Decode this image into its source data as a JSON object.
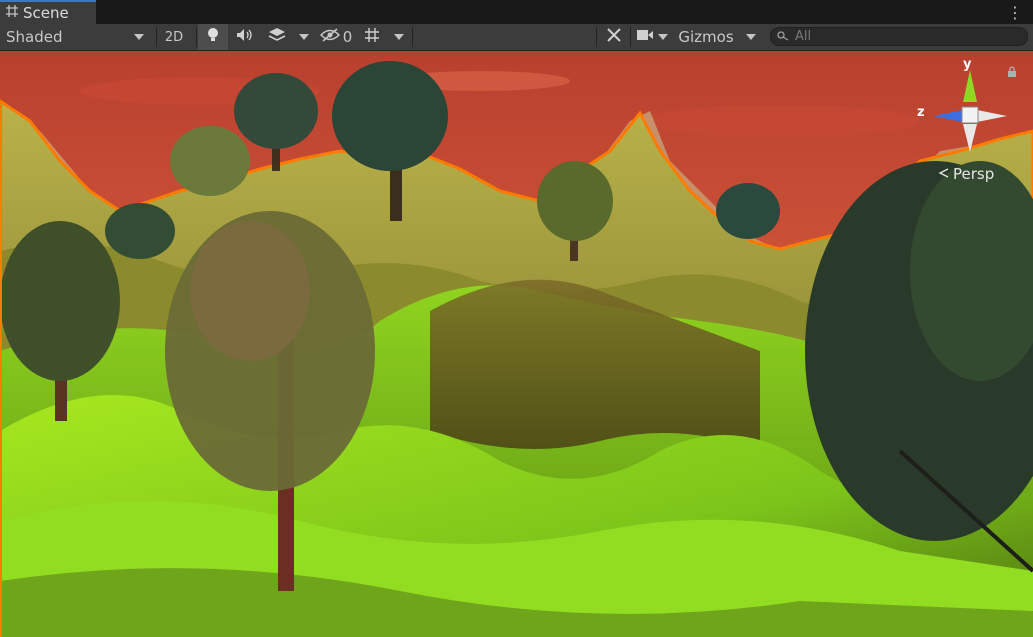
{
  "window": {
    "tab_title": "Scene"
  },
  "toolbar": {
    "draw_mode": "Shaded",
    "mode_2d": "2D",
    "hidden_count": "0",
    "gizmos": "Gizmos",
    "search_placeholder": "All"
  },
  "gizmo": {
    "y": "y",
    "z": "z",
    "projection": "Persp"
  },
  "colors": {
    "sky": "#c9553a",
    "selection_outline": "#ff7a00",
    "grass": "#7fd51f"
  }
}
